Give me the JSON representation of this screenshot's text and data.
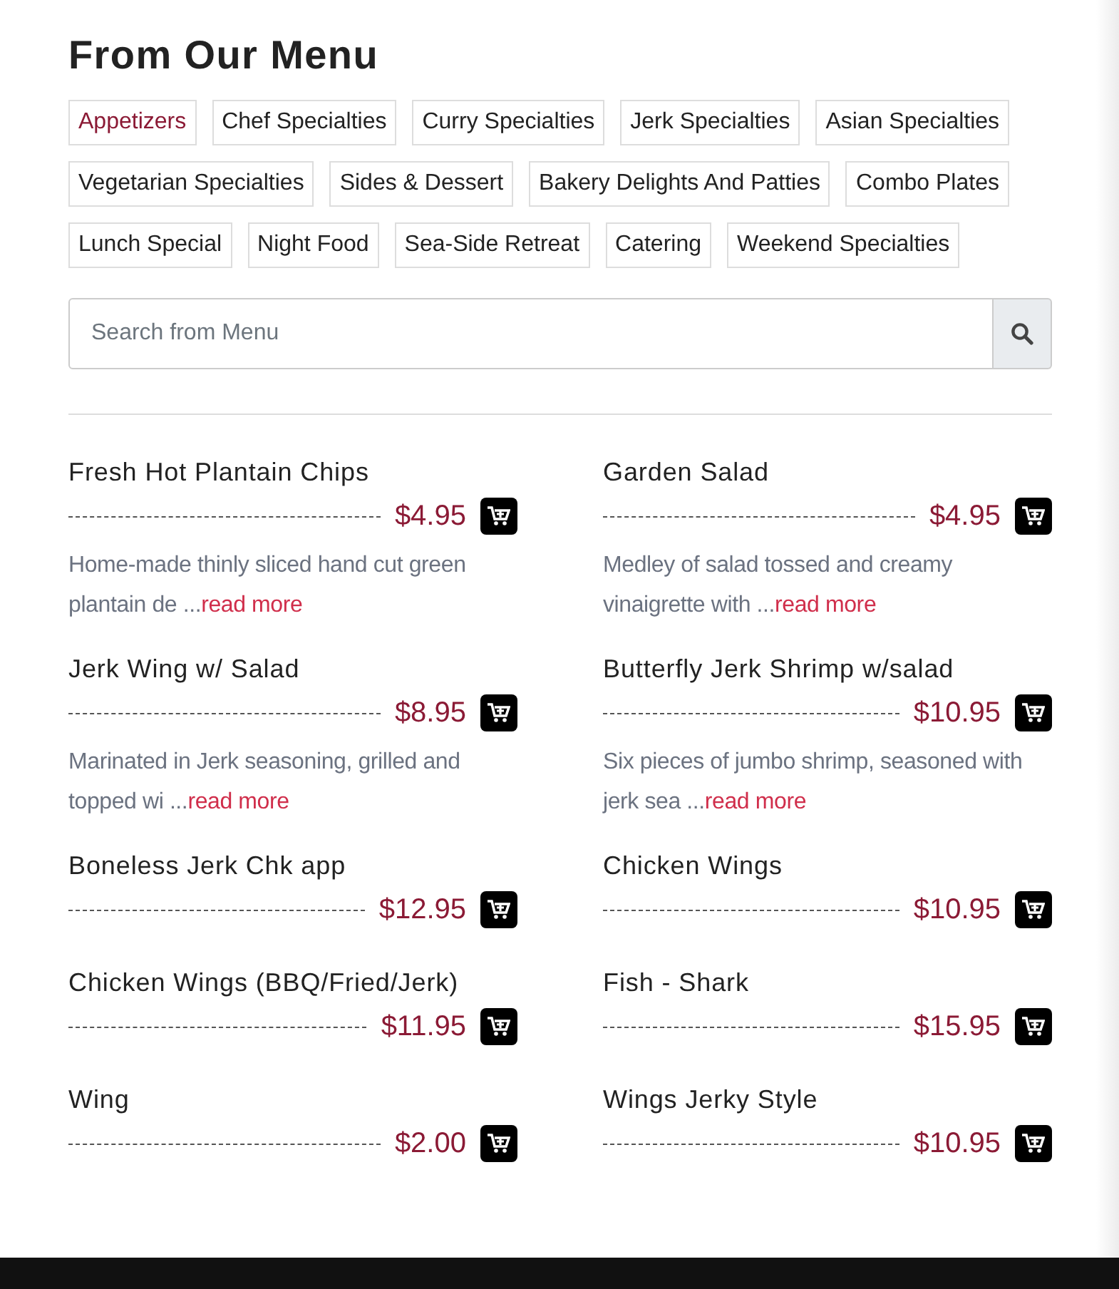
{
  "title": "From Our Menu",
  "categories": [
    {
      "label": "Appetizers",
      "selected": true
    },
    {
      "label": "Chef Specialties",
      "selected": false
    },
    {
      "label": "Curry Specialties",
      "selected": false
    },
    {
      "label": "Jerk Specialties",
      "selected": false
    },
    {
      "label": "Asian Specialties",
      "selected": false
    },
    {
      "label": "Vegetarian Specialties",
      "selected": false
    },
    {
      "label": "Sides & Dessert",
      "selected": false
    },
    {
      "label": "Bakery Delights And Patties",
      "selected": false
    },
    {
      "label": "Combo Plates",
      "selected": false
    },
    {
      "label": "Lunch Special",
      "selected": false
    },
    {
      "label": "Night Food",
      "selected": false
    },
    {
      "label": "Sea-Side Retreat",
      "selected": false
    },
    {
      "label": "Catering",
      "selected": false
    },
    {
      "label": "Weekend Specialties",
      "selected": false
    }
  ],
  "search": {
    "placeholder": "Search from Menu"
  },
  "items": [
    {
      "name": "Fresh Hot Plantain Chips",
      "price": "$4.95",
      "description": "Home-made thinly sliced hand cut green plantain de ...",
      "read_more": "read more"
    },
    {
      "name": "Garden Salad",
      "price": "$4.95",
      "description": "Medley of salad tossed and creamy vinaigrette with ...",
      "read_more": "read more"
    },
    {
      "name": "Jerk Wing w/ Salad",
      "price": "$8.95",
      "description": "Marinated in Jerk seasoning, grilled and topped wi ...",
      "read_more": "read more"
    },
    {
      "name": "Butterfly Jerk Shrimp w/salad",
      "price": "$10.95",
      "description": "Six pieces of jumbo shrimp, seasoned with jerk sea ...",
      "read_more": "read more"
    },
    {
      "name": "Boneless Jerk Chk app",
      "price": "$12.95"
    },
    {
      "name": "Chicken Wings",
      "price": "$10.95"
    },
    {
      "name": "Chicken Wings (BBQ/Fried/Jerk)",
      "price": "$11.95"
    },
    {
      "name": "Fish - Shark",
      "price": "$15.95"
    },
    {
      "name": "Wing",
      "price": "$2.00"
    },
    {
      "name": "Wings Jerky Style",
      "price": "$10.95"
    }
  ]
}
